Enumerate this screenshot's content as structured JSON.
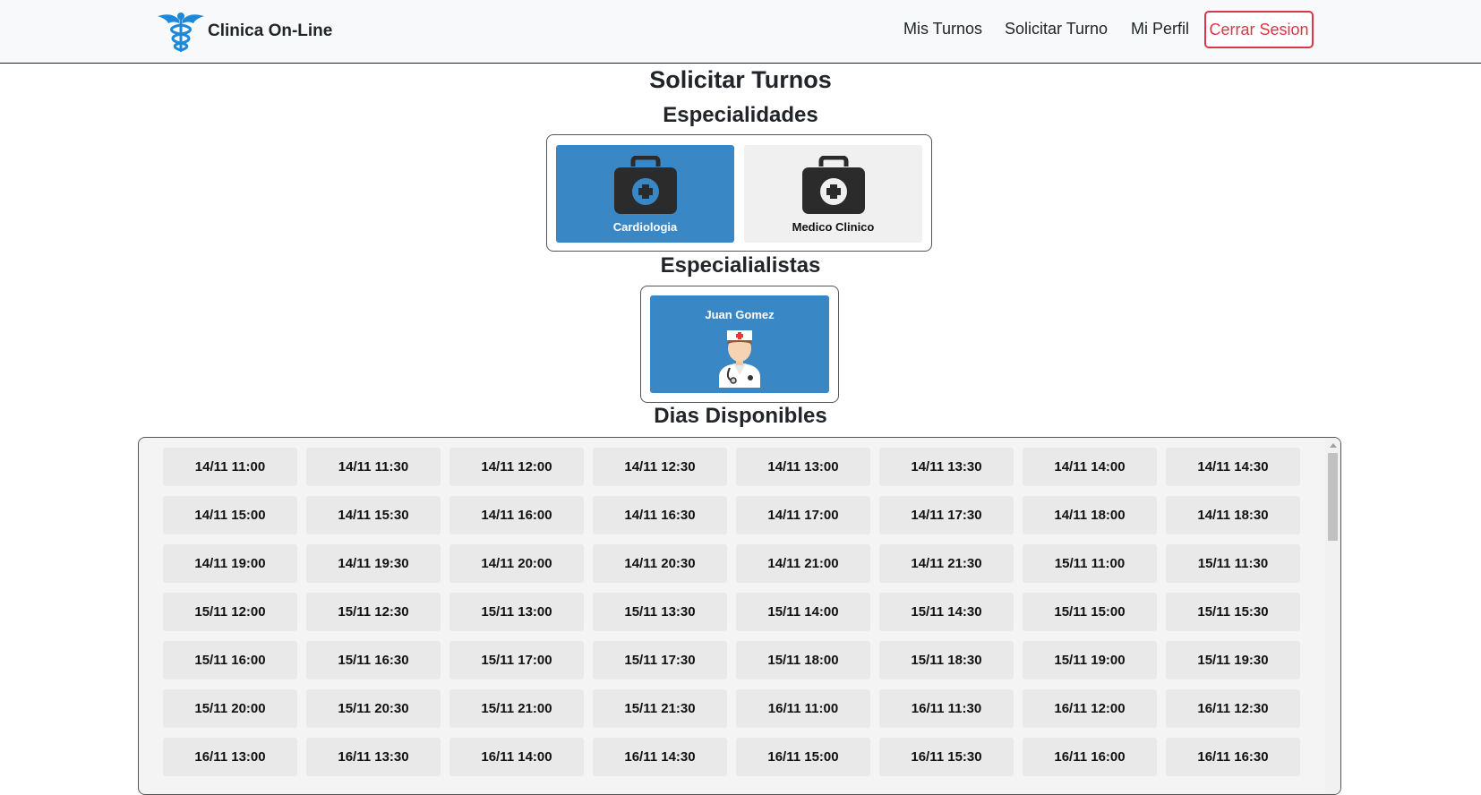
{
  "brand": {
    "name": "Clinica On-Line",
    "logo_icon": "caduceus-icon",
    "logo_color": "#1e88d8"
  },
  "nav": {
    "items": [
      "Mis Turnos",
      "Solicitar Turno",
      "Mi Perfil"
    ],
    "logout_label": "Cerrar Sesion",
    "logout_color": "#dc3545"
  },
  "page": {
    "title": "Solicitar Turnos",
    "specialties_heading": "Especialidades",
    "specialists_heading": "Especialialistas",
    "days_heading": "Dias Disponibles"
  },
  "specialties": [
    {
      "label": "Cardiologia",
      "selected": true,
      "icon": "medical-kit-icon"
    },
    {
      "label": "Medico Clinico",
      "selected": false,
      "icon": "medical-kit-icon"
    }
  ],
  "specialists": [
    {
      "name": "Juan Gomez",
      "selected": true,
      "icon": "doctor-avatar-icon"
    }
  ],
  "colors": {
    "selected": "#3a87c6",
    "unselected": "#f0f0f0"
  },
  "slots": [
    "14/11 11:00",
    "14/11 11:30",
    "14/11 12:00",
    "14/11 12:30",
    "14/11 13:00",
    "14/11 13:30",
    "14/11 14:00",
    "14/11 14:30",
    "14/11 15:00",
    "14/11 15:30",
    "14/11 16:00",
    "14/11 16:30",
    "14/11 17:00",
    "14/11 17:30",
    "14/11 18:00",
    "14/11 18:30",
    "14/11 19:00",
    "14/11 19:30",
    "14/11 20:00",
    "14/11 20:30",
    "14/11 21:00",
    "14/11 21:30",
    "15/11 11:00",
    "15/11 11:30",
    "15/11 12:00",
    "15/11 12:30",
    "15/11 13:00",
    "15/11 13:30",
    "15/11 14:00",
    "15/11 14:30",
    "15/11 15:00",
    "15/11 15:30",
    "15/11 16:00",
    "15/11 16:30",
    "15/11 17:00",
    "15/11 17:30",
    "15/11 18:00",
    "15/11 18:30",
    "15/11 19:00",
    "15/11 19:30",
    "15/11 20:00",
    "15/11 20:30",
    "15/11 21:00",
    "15/11 21:30",
    "16/11 11:00",
    "16/11 11:30",
    "16/11 12:00",
    "16/11 12:30",
    "16/11 13:00",
    "16/11 13:30",
    "16/11 14:00",
    "16/11 14:30",
    "16/11 15:00",
    "16/11 15:30",
    "16/11 16:00",
    "16/11 16:30"
  ]
}
